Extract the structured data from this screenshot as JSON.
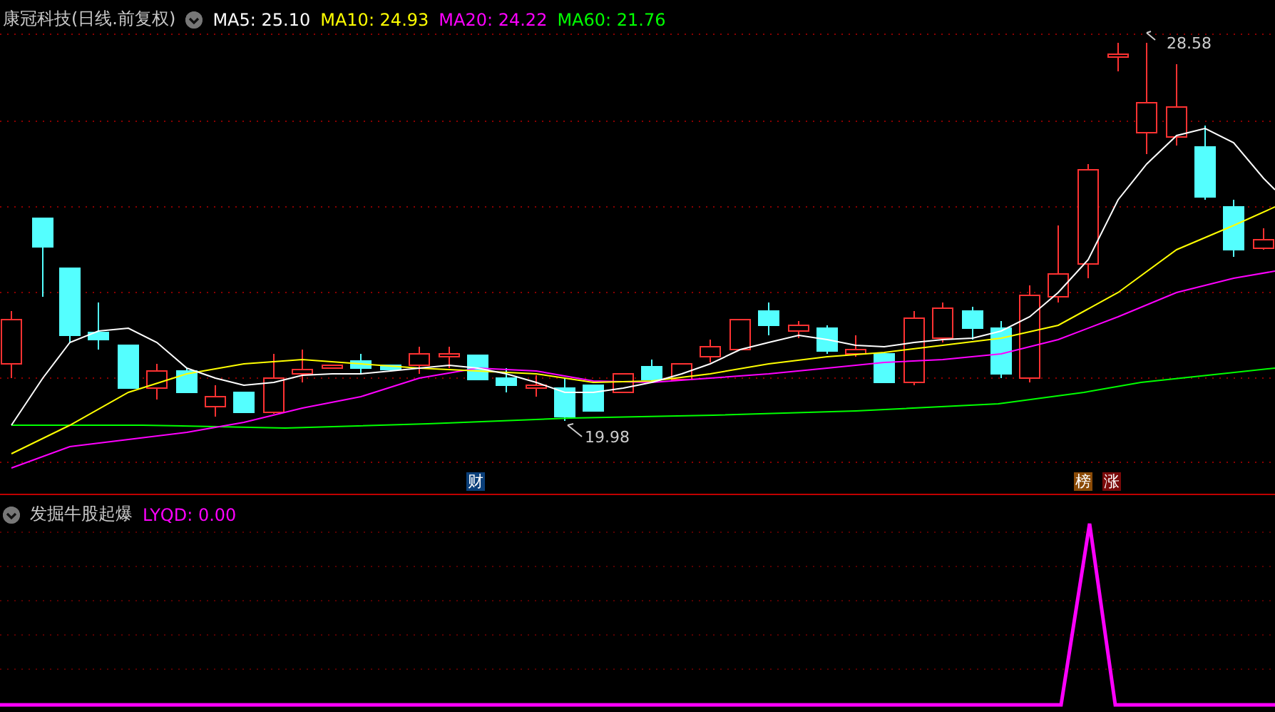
{
  "main_panel": {
    "title": "康冠科技(日线.前复权)",
    "indicators": [
      {
        "label": "MA5: 25.10",
        "color": "#ffffff"
      },
      {
        "label": "MA10: 24.93",
        "color": "#ffff00"
      },
      {
        "label": "MA20: 24.22",
        "color": "#ff00ff"
      },
      {
        "label": "MA60: 21.76",
        "color": "#00ff00"
      }
    ],
    "high_label": "28.58",
    "low_label": "19.98",
    "event_tags": [
      {
        "text": "财",
        "color": "#0a3f7a"
      },
      {
        "text": "榜",
        "color": "#8a4a06"
      },
      {
        "text": "涨",
        "color": "#7a0a0a"
      }
    ]
  },
  "sub_panel": {
    "title": "发掘牛股起爆",
    "indicator": "LYQD: 0.00"
  }
}
